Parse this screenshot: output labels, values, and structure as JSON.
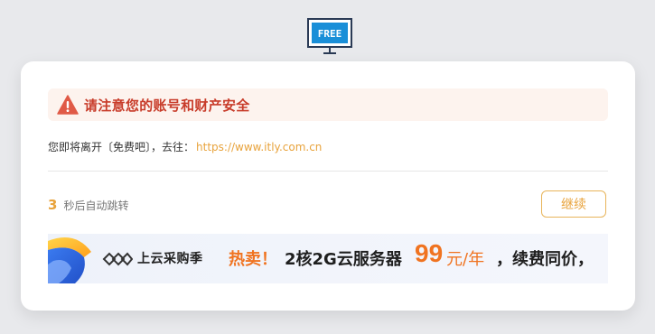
{
  "logo": {
    "text": "FREE",
    "icon": "free-monitor-icon"
  },
  "warning": {
    "icon": "warning-triangle-icon",
    "text": "请注意您的账号和财产安全"
  },
  "leaving": {
    "prefix": "您即将离开〔免费吧〕，去往：",
    "url": "https://www.itly.com.cn"
  },
  "countdown": {
    "seconds": "3",
    "label": "秒后自动跳转"
  },
  "continue_button": {
    "label": "继续"
  },
  "banner": {
    "brand": "上云采购季",
    "hot": "热卖！",
    "offer": "2核2G云服务器",
    "price": "99",
    "unit": "元/年",
    "tail": "，续费同价，"
  },
  "colors": {
    "accent": "#e8a33c",
    "warning_red": "#c83c2a",
    "banner_orange": "#f07320",
    "logo_blue": "#1a8fd8"
  }
}
